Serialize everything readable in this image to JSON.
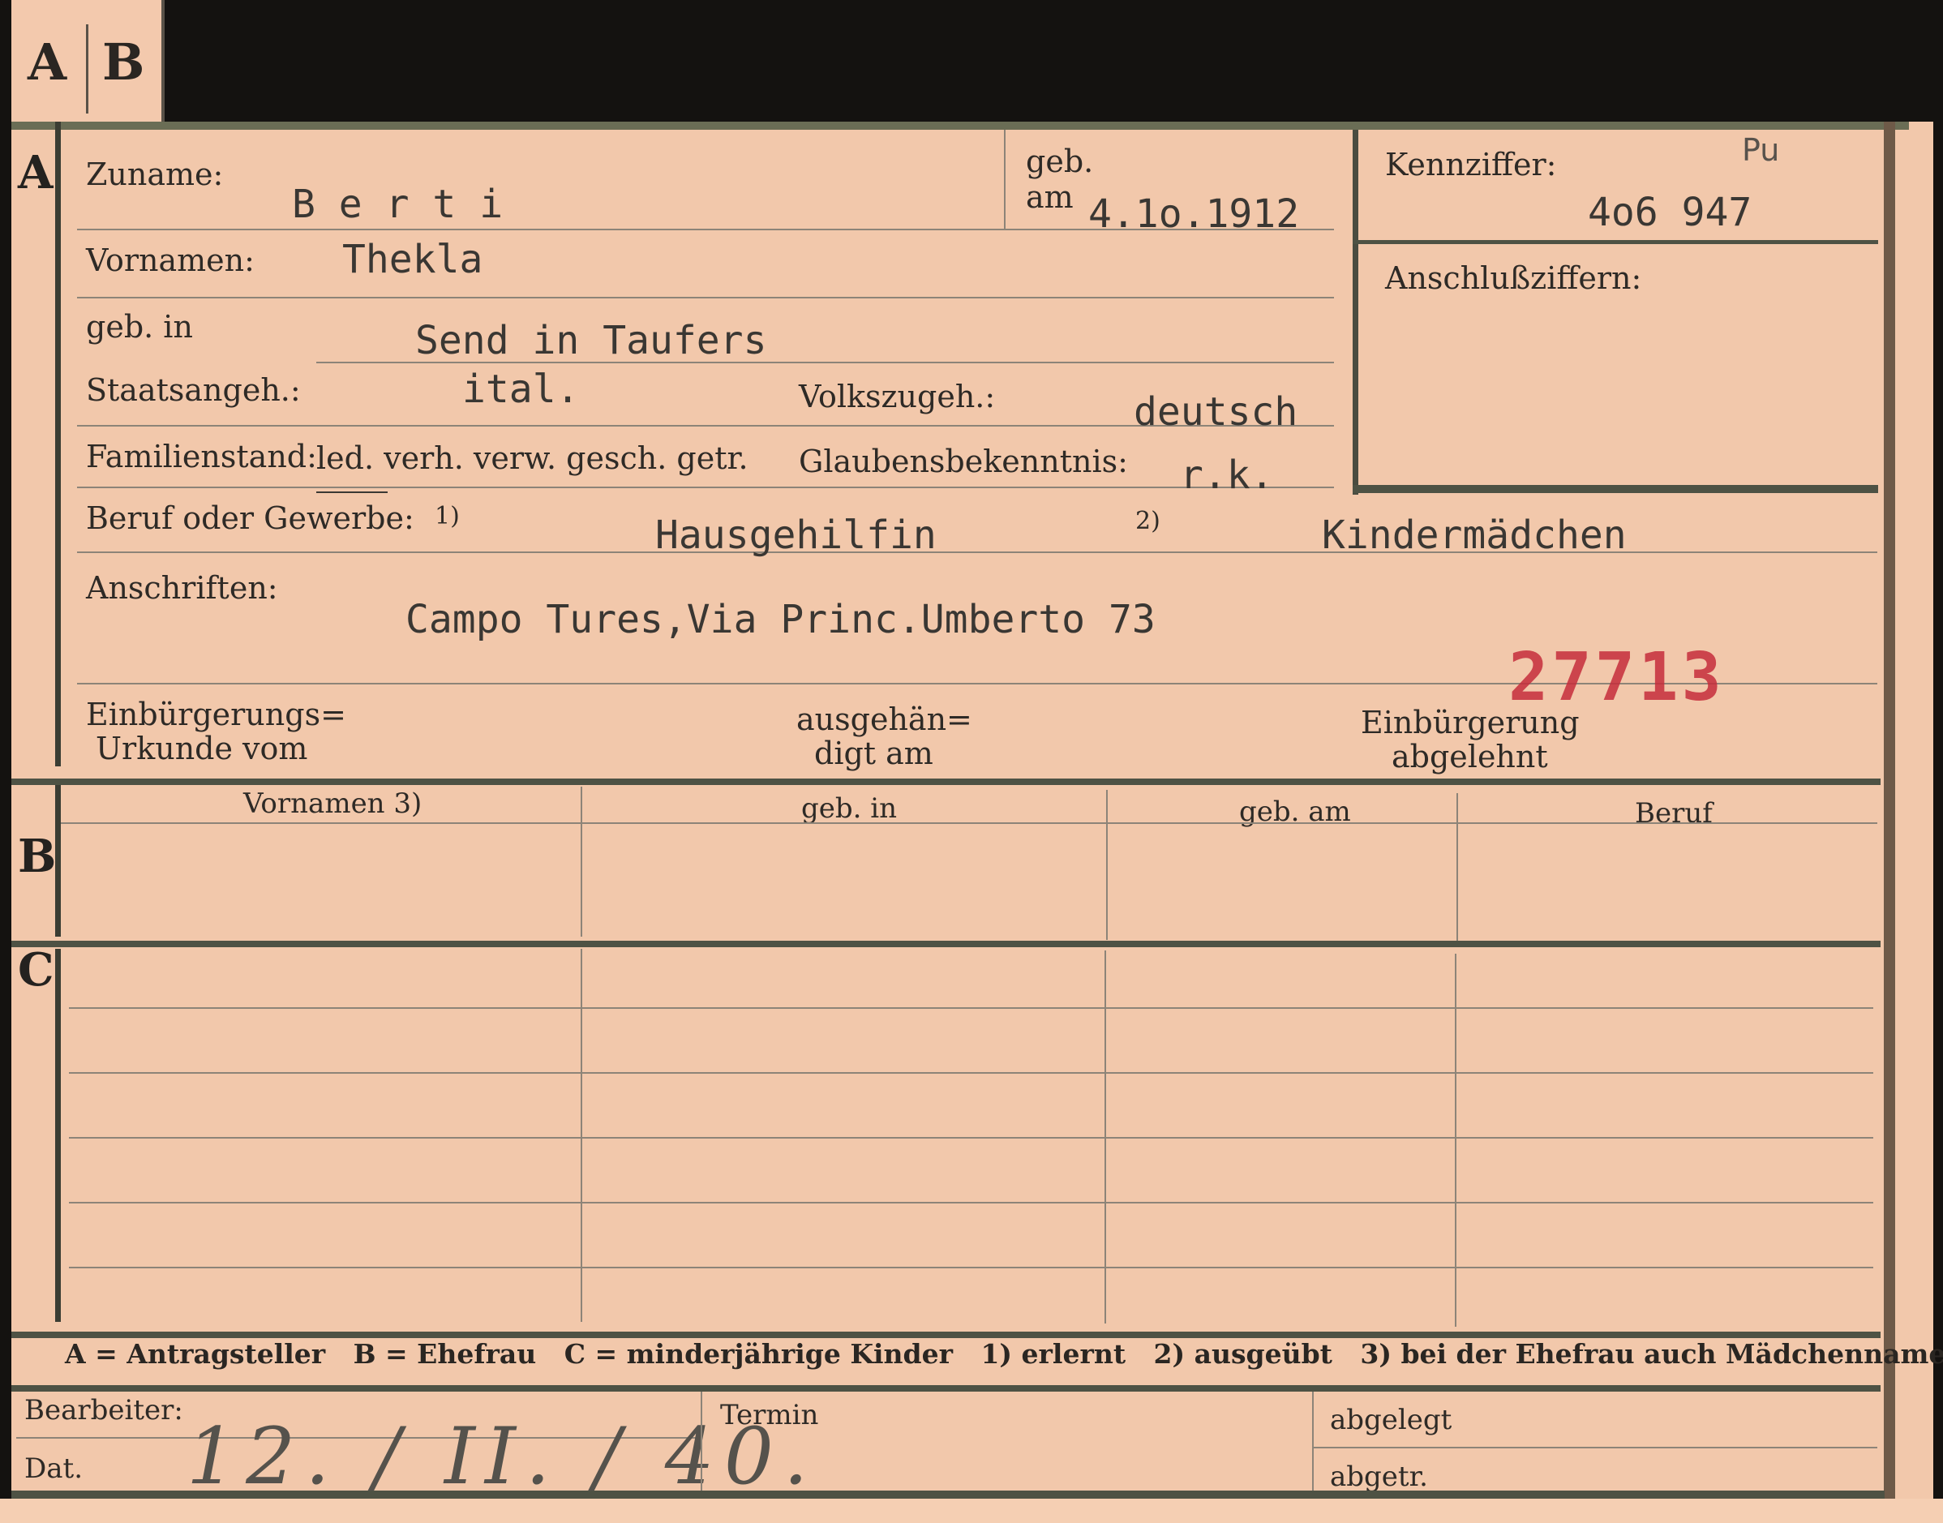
{
  "tab": {
    "left_letter": "A",
    "right_letter": "B"
  },
  "sections": {
    "a": "A",
    "b": "B",
    "c": "C"
  },
  "fields": {
    "zuname_label": "Zuname:",
    "zuname_value": "B e r t i",
    "geb_label": "geb.",
    "am_label": "am",
    "geb_am_value": "4.1o.1912",
    "kennziffer_label": "Kennziffer:",
    "kennziffer_code": "Pu",
    "kennziffer_value": "4o6 947",
    "anschluss_label": "Anschlußziffern:",
    "vornamen_label": "Vornamen:",
    "vornamen_value": "Thekla",
    "geb_in_label": "geb. in",
    "geb_in_value": "Send in Taufers",
    "staatsangeh_label": "Staatsangeh.:",
    "staatsangeh_value": "ital.",
    "volkszugeh_label": "Volkszugeh.:",
    "volkszugeh_value": "deutsch",
    "familienstand_label": "Familienstand:",
    "familienstand_options": "led. verh. verw. gesch. getr.",
    "glaubens_label": "Glaubensbekenntnis:",
    "glaubens_value": "r.k.",
    "beruf_label": "Beruf oder Gewerbe:",
    "beruf_note1": "1)",
    "beruf_value1": "Hausgehilfin",
    "beruf_note2": "2)",
    "beruf_value2": "Kindermädchen",
    "anschriften_label": "Anschriften:",
    "anschriften_value": "Campo Tures,Via Princ.Umberto 73",
    "stamp_number": "27713",
    "einb_urkunde_line1": "Einbürgerungs=",
    "einb_urkunde_line2": "Urkunde vom",
    "ausgehaen_line1": "ausgehän=",
    "ausgehaen_line2": "digt am",
    "einb_abgelehnt_line1": "Einbürgerung",
    "einb_abgelehnt_line2": "abgelehnt"
  },
  "table": {
    "headers": [
      "Vornamen 3)",
      "geb. in",
      "geb. am",
      "Beruf"
    ]
  },
  "legend": "A = Antragsteller   B = Ehefrau   C = minderjährige Kinder   1) erlernt   2) ausgeübt   3) bei der Ehefrau auch Mädchenname",
  "footer": {
    "bearbeiter_label": "Bearbeiter:",
    "dat_label": "Dat.",
    "dat_value": "12. / II. / 40.",
    "termin_label": "Termin",
    "abgelegt_label": "abgelegt",
    "abgetr_label": "abgetr."
  }
}
